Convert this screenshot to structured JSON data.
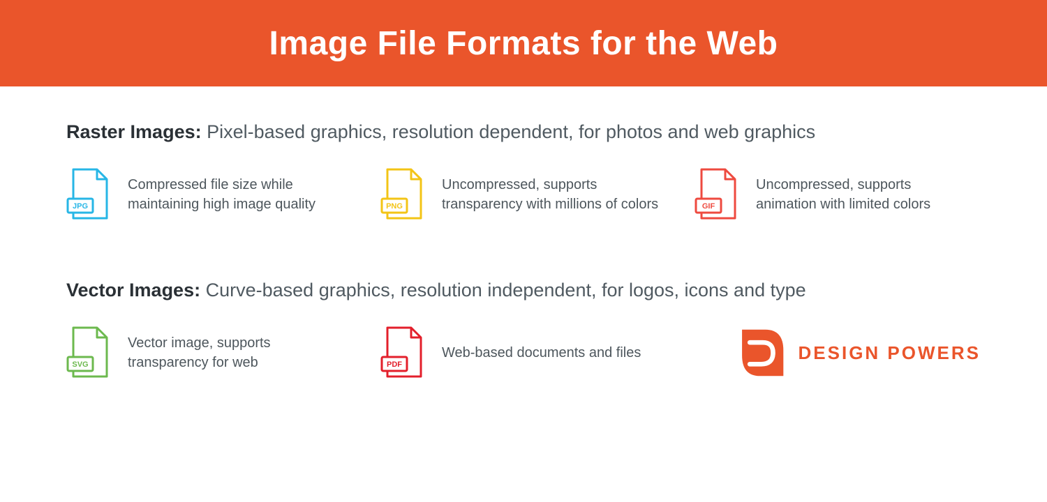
{
  "banner": {
    "title": "Image File Formats for the Web"
  },
  "sections": {
    "raster": {
      "label": "Raster Images:",
      "desc": "Pixel-based graphics, resolution dependent, for photos and web graphics",
      "items": [
        {
          "code": "JPG",
          "color": "–",
          "text": "Compressed file size while maintaining high image quality"
        },
        {
          "code": "PNG",
          "color": "–",
          "text": "Uncompressed, supports transparency with millions of colors"
        },
        {
          "code": "GIF",
          "color": "–",
          "text": "Uncompressed, supports animation with limited colors"
        }
      ]
    },
    "vector": {
      "label": "Vector Images:",
      "desc": "Curve-based graphics, resolution independent, for logos, icons and type",
      "items": [
        {
          "code": "SVG",
          "color": "–",
          "text": "Vector image, supports transparency for web"
        },
        {
          "code": "PDF",
          "color": "–",
          "text": "Web-based documents and files"
        }
      ]
    }
  },
  "brand": {
    "name": "DESIGN POWERS"
  },
  "colors": {
    "accent": "#ea552b",
    "jpg": "#27b6e6",
    "png": "#f3c416",
    "gif": "#ee4a3f",
    "svg": "#6cb94e",
    "pdf": "#e31f2b"
  }
}
